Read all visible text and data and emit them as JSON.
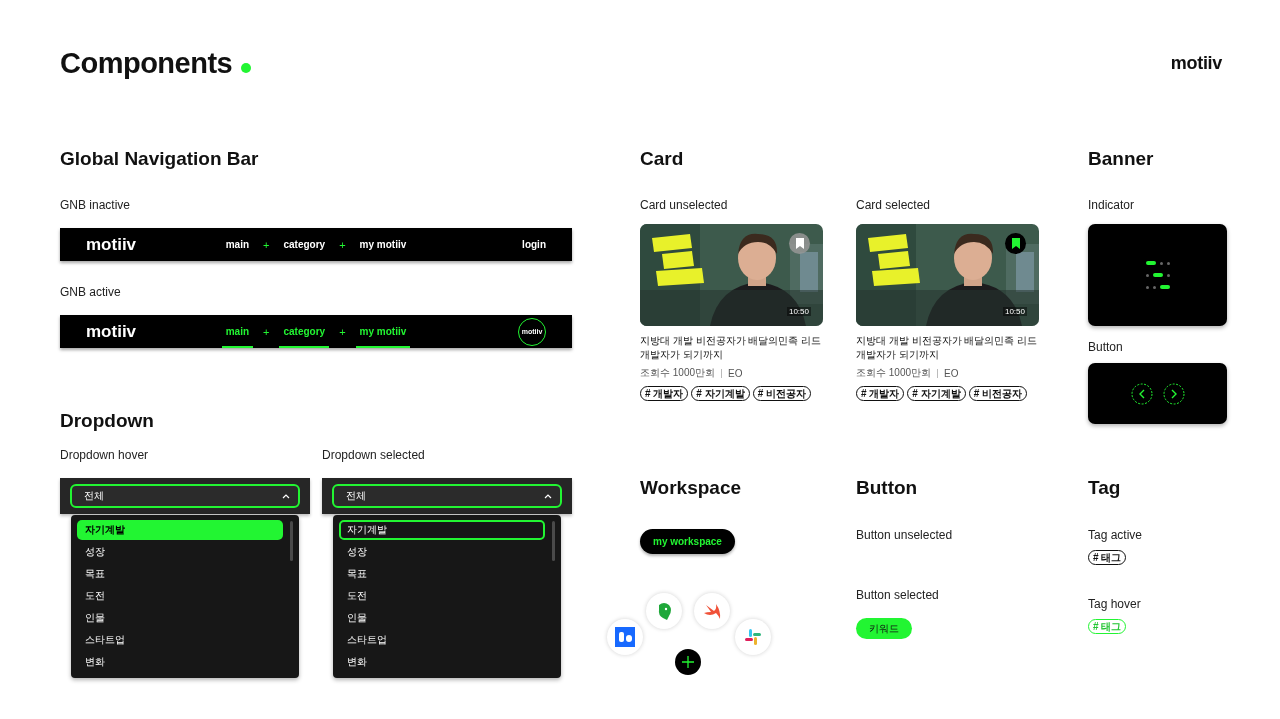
{
  "header": {
    "title": "Components",
    "logo": "motiiv"
  },
  "gnb": {
    "title": "Global Navigation Bar",
    "variants": [
      {
        "label": "GNB inactive",
        "logo": "motiiv",
        "items": [
          {
            "kind": "link",
            "text": "main",
            "selected": false
          },
          {
            "kind": "separator",
            "text": "+"
          },
          {
            "kind": "link",
            "text": "category",
            "selected": false
          },
          {
            "kind": "separator",
            "text": "+"
          },
          {
            "kind": "link",
            "text": "my motiiv",
            "selected": false
          }
        ],
        "login": "login"
      },
      {
        "label": "GNB active",
        "logo": "motiiv",
        "items": [
          {
            "kind": "link",
            "text": "main",
            "selected": true
          },
          {
            "kind": "separator",
            "text": "+"
          },
          {
            "kind": "link",
            "text": "category",
            "selected": true
          },
          {
            "kind": "separator",
            "text": "+"
          },
          {
            "kind": "link",
            "text": "my motiiv",
            "selected": true
          }
        ],
        "avatar": "motiiv"
      }
    ]
  },
  "dropdown": {
    "title": "Dropdown",
    "variants": [
      {
        "label": "Dropdown hover",
        "kind": "hover",
        "value": "전체",
        "options": [
          {
            "text": "자기계발",
            "selected": true
          },
          {
            "text": "성장",
            "selected": false
          },
          {
            "text": "목표",
            "selected": false
          },
          {
            "text": "도전",
            "selected": false
          },
          {
            "text": "인물",
            "selected": false
          },
          {
            "text": "스타트업",
            "selected": false
          },
          {
            "text": "변화",
            "selected": false
          }
        ]
      },
      {
        "label": "Dropdown selected",
        "kind": "outlined",
        "value": "전체",
        "options": [
          {
            "text": "자기계발",
            "selected": true
          },
          {
            "text": "성장",
            "selected": false
          },
          {
            "text": "목표",
            "selected": false
          },
          {
            "text": "도전",
            "selected": false
          },
          {
            "text": "인물",
            "selected": false
          },
          {
            "text": "스타트업",
            "selected": false
          },
          {
            "text": "변화",
            "selected": false
          }
        ]
      }
    ]
  },
  "card": {
    "title": "Card",
    "variants": [
      {
        "label": "Card unselected",
        "bookmarked": false,
        "duration": "10:50",
        "title": "지방대 개발 비전공자가 배달의민족 리드 개발자가 되기까지",
        "views": "조회수 1000만회",
        "channel": "EO",
        "tags": [
          "# 개발자",
          "# 자기계발",
          "# 비전공자"
        ]
      },
      {
        "label": "Card selected",
        "bookmarked": true,
        "duration": "10:50",
        "title": "지방대 개발 비전공자가 배달의민족 리드 개발자가 되기까지",
        "views": "조회수 1000만회",
        "channel": "EO",
        "tags": [
          "# 개발자",
          "# 자기계발",
          "# 비전공자"
        ]
      }
    ]
  },
  "banner": {
    "title": "Banner",
    "indicator_label": "Indicator",
    "indicator_rows": [
      {
        "dots": [
          {
            "selected": true
          },
          {
            "selected": false
          },
          {
            "selected": false
          }
        ]
      },
      {
        "dots": [
          {
            "selected": false
          },
          {
            "selected": true
          },
          {
            "selected": false
          }
        ]
      },
      {
        "dots": [
          {
            "selected": false
          },
          {
            "selected": false
          },
          {
            "selected": true
          }
        ]
      }
    ],
    "button_label": "Button"
  },
  "workspace": {
    "title": "Workspace",
    "button": "my workspace"
  },
  "buttons": {
    "title": "Button",
    "variants": [
      {
        "label": "Button unselected"
      },
      {
        "label": "Button selected",
        "button": {
          "text": "키워드",
          "selected": true
        }
      }
    ]
  },
  "tag": {
    "title": "Tag",
    "variants": [
      {
        "label": "Tag active",
        "text": "# 태그",
        "kind": "plain"
      },
      {
        "label": "Tag hover",
        "text": "# 태그",
        "kind": "green"
      }
    ]
  }
}
